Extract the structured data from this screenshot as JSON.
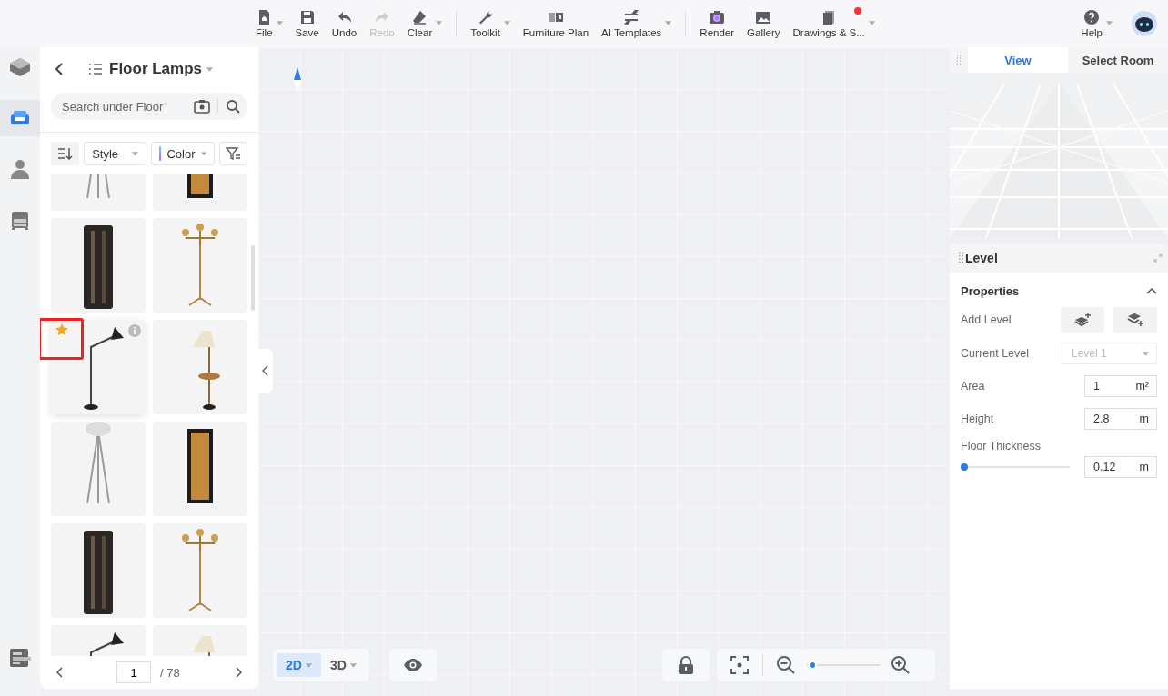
{
  "toolbar": {
    "groups": [
      [
        {
          "label": "File",
          "has_menu": true,
          "disabled": false,
          "badge": false
        },
        {
          "label": "Save",
          "has_menu": false,
          "disabled": false,
          "badge": false
        },
        {
          "label": "Undo",
          "has_menu": false,
          "disabled": false,
          "badge": false
        },
        {
          "label": "Redo",
          "has_menu": false,
          "disabled": true,
          "badge": false
        },
        {
          "label": "Clear",
          "has_menu": true,
          "disabled": false,
          "badge": false
        }
      ],
      [
        {
          "label": "Toolkit",
          "has_menu": true,
          "disabled": false,
          "badge": false
        },
        {
          "label": "Furniture Plan",
          "has_menu": false,
          "disabled": false,
          "badge": false
        },
        {
          "label": "AI Templates",
          "has_menu": true,
          "disabled": false,
          "badge": false
        }
      ],
      [
        {
          "label": "Render",
          "has_menu": false,
          "disabled": false,
          "badge": false
        },
        {
          "label": "Gallery",
          "has_menu": false,
          "disabled": false,
          "badge": false
        },
        {
          "label": "Drawings & S...",
          "has_menu": true,
          "disabled": false,
          "badge": true
        }
      ]
    ],
    "help": {
      "label": "Help",
      "has_menu": true
    }
  },
  "rail": [
    {
      "selected": false
    },
    {
      "selected": true
    },
    {
      "selected": false
    },
    {
      "selected": false
    }
  ],
  "catalog": {
    "title": "Floor Lamps",
    "search": {
      "placeholder": "Search under Floor"
    },
    "filters": [
      {
        "label": "Style"
      },
      {
        "label": "Color"
      }
    ],
    "products": [
      {
        "hovered": false
      },
      {
        "hovered": false
      },
      {
        "favorite": false,
        "hovered": false,
        "highlighted": false
      },
      {
        "favorite": false,
        "hovered": false,
        "highlighted": false
      },
      {
        "favorite": true,
        "hovered": true,
        "highlighted": true
      },
      {
        "favorite": false,
        "hovered": false,
        "highlighted": false
      },
      {
        "favorite": false,
        "hovered": false,
        "highlighted": false
      },
      {
        "favorite": false,
        "hovered": false,
        "highlighted": false
      },
      {
        "favorite": false,
        "hovered": false,
        "highlighted": false
      },
      {
        "favorite": false,
        "hovered": false,
        "highlighted": false
      },
      {
        "favorite": false,
        "hovered": false,
        "highlighted": false
      },
      {
        "favorite": false,
        "hovered": false,
        "highlighted": false
      }
    ],
    "page": "1",
    "total": "/ 78"
  },
  "canvas": {
    "view_modes": [
      {
        "label": "2D",
        "selected": true
      },
      {
        "label": "3D",
        "selected": false
      }
    ],
    "zoom": {
      "level": 0.02
    }
  },
  "view_panel": {
    "tabs": [
      {
        "label": "View",
        "selected": true
      },
      {
        "label": "Select Room",
        "selected": false
      }
    ]
  },
  "level_panel": {
    "title": "Level",
    "section": {
      "title": "Properties",
      "expanded": true
    },
    "rows": [
      {
        "kind": "buttons",
        "label": "Add Level"
      },
      {
        "kind": "select",
        "label": "Current Level",
        "value": "Level 1",
        "disabled": true
      },
      {
        "kind": "input",
        "label": "Area",
        "value": "1",
        "unit": "m²"
      },
      {
        "kind": "input",
        "label": "Height",
        "value": "2.8",
        "unit": "m"
      },
      {
        "kind": "slider",
        "label": "Floor Thickness",
        "level": 0,
        "value": "0.12",
        "unit": "m"
      }
    ]
  }
}
